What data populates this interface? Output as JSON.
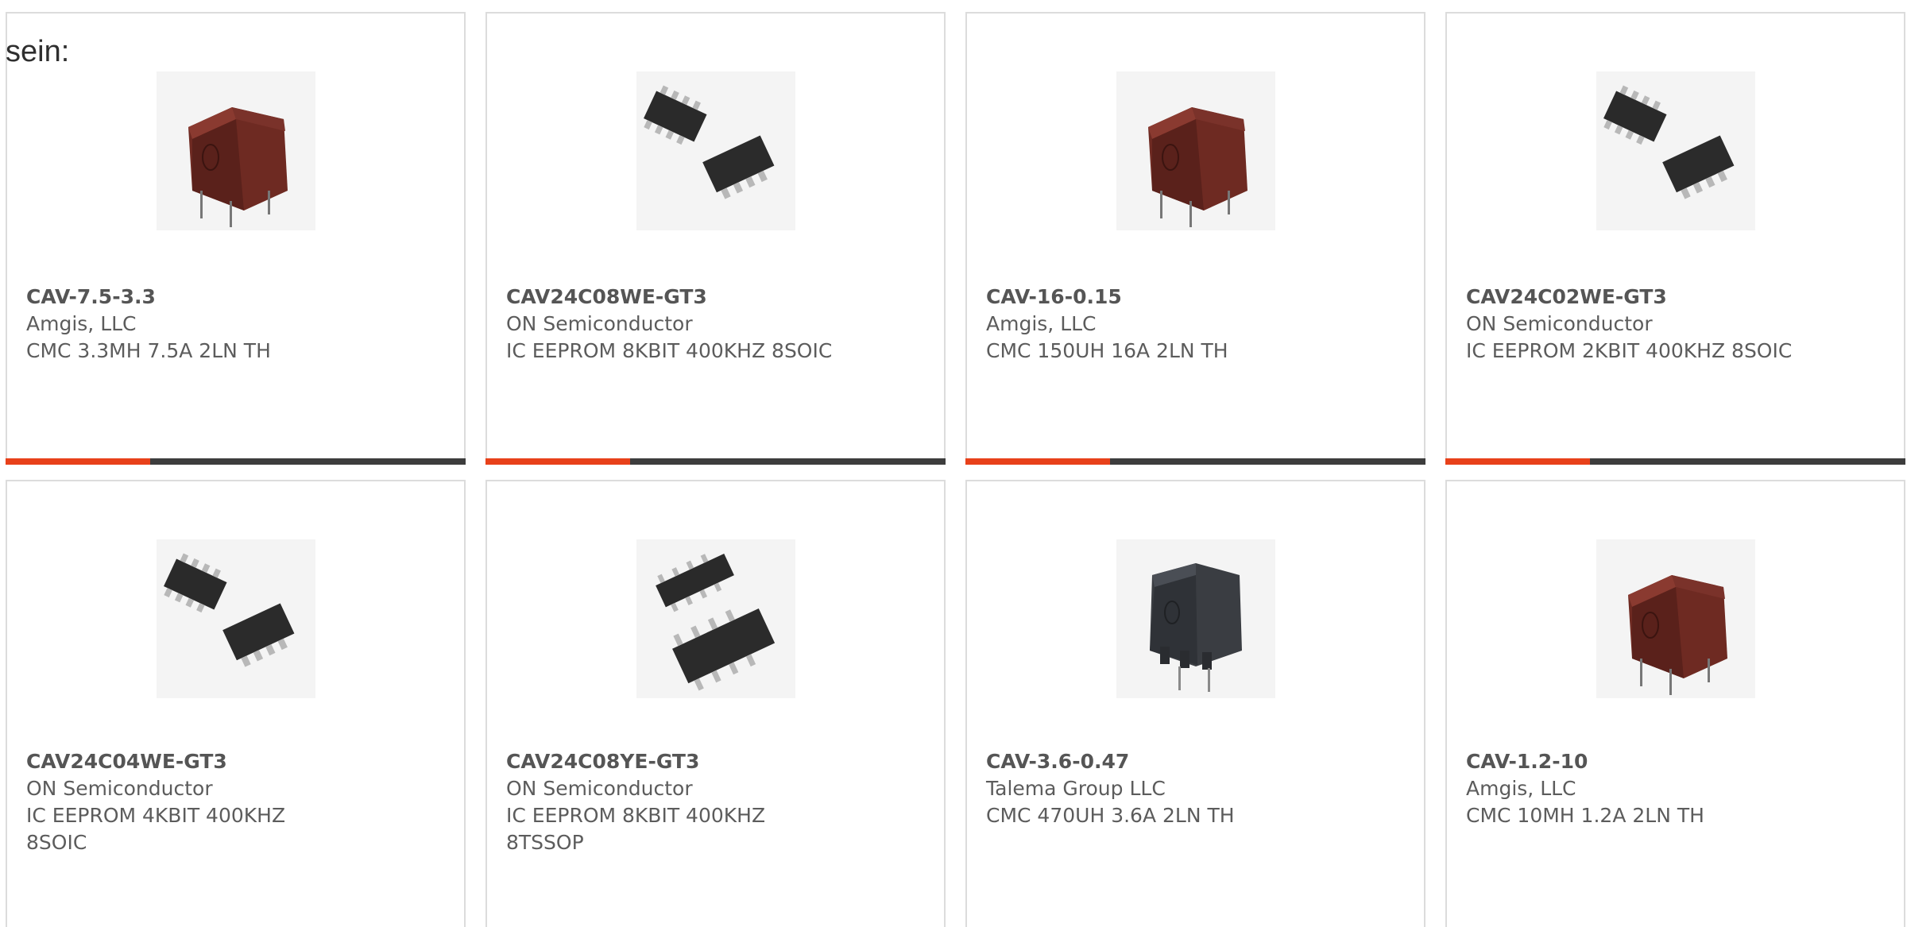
{
  "lead_text": "sein:",
  "accent_color": "#e8411a",
  "bar_color": "#3d3d3d",
  "products": [
    {
      "part_number": "CAV-7.5-3.3",
      "manufacturer": "Amgis, LLC",
      "description": "CMC 3.3MH 7.5A 2LN TH",
      "image": "red-common-mode-choke-icon",
      "progress": 0.315
    },
    {
      "part_number": "CAV24C08WE-GT3",
      "manufacturer": "ON Semiconductor",
      "description": "IC EEPROM 8KBIT 400KHZ 8SOIC",
      "image": "soic-8-chip-pair-icon",
      "progress": 0.315
    },
    {
      "part_number": "CAV-16-0.15",
      "manufacturer": "Amgis, LLC",
      "description": "CMC 150UH 16A 2LN TH",
      "image": "red-common-mode-choke-icon",
      "progress": 0.315
    },
    {
      "part_number": "CAV24C02WE-GT3",
      "manufacturer": "ON Semiconductor",
      "description": "IC EEPROM 2KBIT 400KHZ 8SOIC",
      "image": "soic-8-chip-pair-icon",
      "progress": 0.315
    },
    {
      "part_number": "CAV24C04WE-GT3",
      "manufacturer": "ON Semiconductor",
      "description": "IC EEPROM 4KBIT 400KHZ 8SOIC",
      "image": "soic-8-chip-pair-icon"
    },
    {
      "part_number": "CAV24C08YE-GT3",
      "manufacturer": "ON Semiconductor",
      "description": "IC EEPROM 8KBIT 400KHZ 8TSSOP",
      "image": "tssop-8-chip-pair-icon"
    },
    {
      "part_number": "CAV-3.6-0.47",
      "manufacturer": "Talema Group LLC",
      "description": "CMC 470UH 3.6A 2LN TH",
      "image": "black-common-mode-choke-icon"
    },
    {
      "part_number": "CAV-1.2-10",
      "manufacturer": "Amgis, LLC",
      "description": "CMC 10MH 1.2A 2LN TH",
      "image": "red-common-mode-choke-icon"
    }
  ]
}
